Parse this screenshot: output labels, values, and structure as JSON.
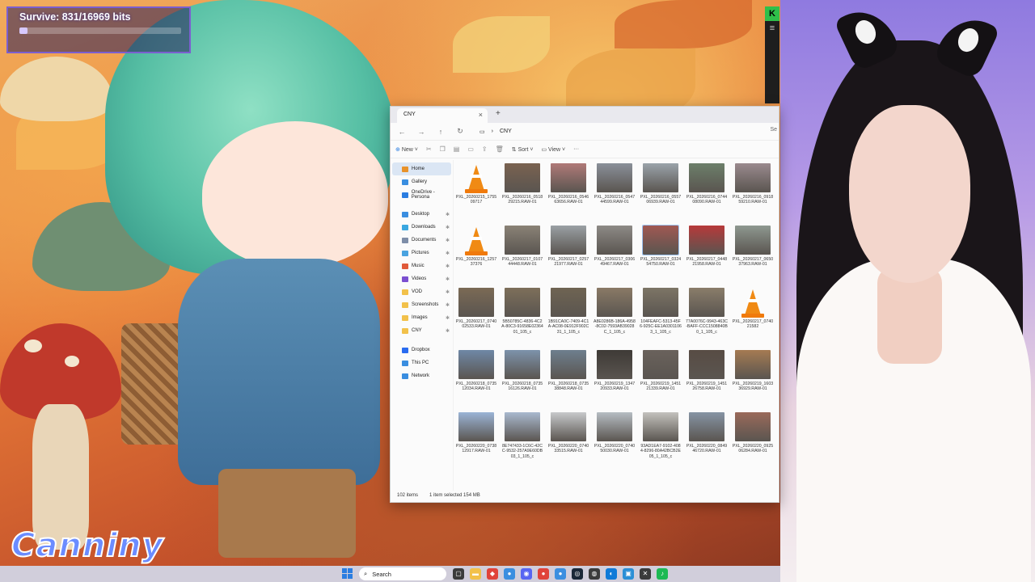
{
  "stream_overlay": {
    "survive_text": "Survive: 831/16969 bits",
    "survive_progress": 0.049,
    "logo_text": "Canniny"
  },
  "explorer": {
    "tab_title": "CNY",
    "path": "CNY",
    "search_stub": "Se",
    "toolbar": {
      "new_label": "New",
      "sort_label": "Sort",
      "view_label": "View"
    },
    "nav": [
      {
        "label": "Home",
        "icon": "home-icon",
        "color": "#e8922a",
        "selected": true
      },
      {
        "label": "Gallery",
        "icon": "gallery-icon",
        "color": "#3a8ee0"
      },
      {
        "label": "OneDrive - Persona",
        "icon": "cloud-icon",
        "color": "#2a7de1"
      },
      {
        "label": "Desktop",
        "icon": "desktop-icon",
        "color": "#3a8ee0",
        "pinned": true
      },
      {
        "label": "Downloads",
        "icon": "download-icon",
        "color": "#3aa7e0",
        "pinned": true
      },
      {
        "label": "Documents",
        "icon": "document-icon",
        "color": "#7e8ea8",
        "pinned": true
      },
      {
        "label": "Pictures",
        "icon": "picture-icon",
        "color": "#4aa3e0",
        "pinned": true
      },
      {
        "label": "Music",
        "icon": "music-icon",
        "color": "#e05a3a",
        "pinned": true
      },
      {
        "label": "Videos",
        "icon": "video-icon",
        "color": "#7b4fd0",
        "pinned": true
      },
      {
        "label": "VOD",
        "icon": "folder-icon",
        "color": "#f2c14a",
        "pinned": true
      },
      {
        "label": "Screenshots",
        "icon": "folder-icon",
        "color": "#f2c14a",
        "pinned": true
      },
      {
        "label": "Images",
        "icon": "folder-icon",
        "color": "#f2c14a",
        "pinned": true
      },
      {
        "label": "CNY",
        "icon": "folder-icon",
        "color": "#f2c14a",
        "pinned": true
      },
      {
        "label": "Dropbox",
        "icon": "dropbox-icon",
        "color": "#2a6cf0"
      },
      {
        "label": "This PC",
        "icon": "pc-icon",
        "color": "#3a8ee0"
      },
      {
        "label": "Network",
        "icon": "network-icon",
        "color": "#3a8ee0"
      }
    ],
    "files": [
      {
        "name": "PXL_20260215_175509717",
        "kind": "video"
      },
      {
        "name": "PXL_20260216_051829215.RAW-01",
        "kind": "photo",
        "color": "#7a6250"
      },
      {
        "name": "PXL_20260216_054663656.RAW-01",
        "kind": "photo",
        "color": "#b07a78"
      },
      {
        "name": "PXL_20260216_054744599.RAW-01",
        "kind": "photo",
        "color": "#8a9099"
      },
      {
        "name": "PXL_20260216_055706939.RAW-01",
        "kind": "photo",
        "color": "#9aa3aa"
      },
      {
        "name": "PXL_20260216_074408090.RAW-01",
        "kind": "photo",
        "color": "#6c7f6a"
      },
      {
        "name": "PXL_20260216_091859210.RAW-01",
        "kind": "photo",
        "color": "#9a8a8e"
      },
      {
        "name": "PXL_20260216_125737376",
        "kind": "video"
      },
      {
        "name": "PXL_20260217_010744448.RAW-01",
        "kind": "photo",
        "color": "#8a8276"
      },
      {
        "name": "PXL_20260217_025721977.RAW-01",
        "kind": "photo",
        "color": "#9aa0a4"
      },
      {
        "name": "PXL_20260217_030649467.RAW-01",
        "kind": "photo",
        "color": "#8d8a86"
      },
      {
        "name": "PXL_20260217_032454750.RAW-01",
        "kind": "photo",
        "color": "#a05852",
        "selected": true
      },
      {
        "name": "PXL_20260217_044821958.RAW-01",
        "kind": "photo",
        "color": "#b7393a"
      },
      {
        "name": "PXL_20260217_065037963.RAW-01",
        "kind": "photo",
        "color": "#8e9890"
      },
      {
        "name": "PXL_20260217_074002533.RAW-01",
        "kind": "photo",
        "color": "#7b6a55"
      },
      {
        "name": "5B50785C-4836-4C2A-80C3-91658E0236401_105_c",
        "kind": "photo",
        "color": "#7e6f5a"
      },
      {
        "name": "1B91CA0C-7409-4C1A-AC08-0E912F902C31_1_105_c",
        "kind": "photo",
        "color": "#6f6452"
      },
      {
        "name": "A8E0286B-186A-4958-8C02-7593AB39028C_1_105_c",
        "kind": "photo",
        "color": "#8a7a66"
      },
      {
        "name": "104FEAFC-5313-45F6-925C-EE1A03011063_1_105_c",
        "kind": "photo",
        "color": "#7d7566"
      },
      {
        "name": "77A0076C-9943-463C-BAFF-CCC1508840B0_1_105_c",
        "kind": "photo",
        "color": "#8a7d6a"
      },
      {
        "name": "PXL_20260217_074021582",
        "kind": "video"
      },
      {
        "name": "PXL_20260218_073512034.RAW-01",
        "kind": "photo",
        "color": "#6f88a6"
      },
      {
        "name": "PXL_20260218_073516126.RAW-01",
        "kind": "photo",
        "color": "#7d93ab"
      },
      {
        "name": "PXL_20260218_073538848.RAW-01",
        "kind": "photo",
        "color": "#6e7f8e"
      },
      {
        "name": "PXL_20260219_134720933.RAW-01",
        "kind": "photo",
        "color": "#3e3a36"
      },
      {
        "name": "PXL_20260219_145121339.RAW-01",
        "kind": "photo",
        "color": "#6a625c"
      },
      {
        "name": "PXL_20260219_145126758.RAW-01",
        "kind": "photo",
        "color": "#584c44"
      },
      {
        "name": "PXL_20260219_160336929.RAW-01",
        "kind": "photo",
        "color": "#a57b52"
      },
      {
        "name": "PXL_20260220_073812917.RAW-01",
        "kind": "photo",
        "color": "#9bb4d6"
      },
      {
        "name": "8E747433-1C6C-42CC-9532-257A9E60DB03_1_105_c",
        "kind": "photo",
        "color": "#a9b9cf"
      },
      {
        "name": "PXL_20260220_074033515.RAW-01",
        "kind": "photo",
        "color": "#c7c9cb"
      },
      {
        "name": "PXL_20260220_074050030.RAW-01",
        "kind": "photo",
        "color": "#b6bdc3"
      },
      {
        "name": "93AD1EA7-9102-4084-8296-80A42BCB2E05_1_105_c",
        "kind": "photo",
        "color": "#c3c1bd"
      },
      {
        "name": "PXL_20260220_084946720.RAW-01",
        "kind": "photo",
        "color": "#8694a4"
      },
      {
        "name": "PXL_20260220_092506284.RAW-01",
        "kind": "photo",
        "color": "#9a6a5a"
      }
    ],
    "status": {
      "count": "102 items",
      "selection": "1 item selected  154 MB"
    }
  },
  "taskbar": {
    "search_label": "Search"
  }
}
